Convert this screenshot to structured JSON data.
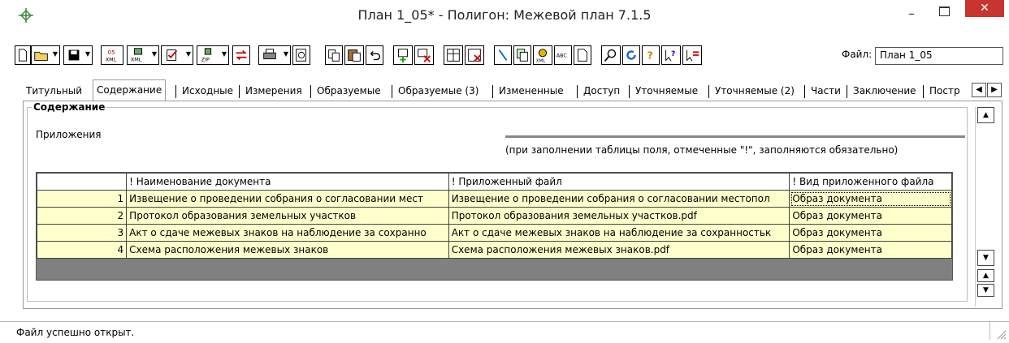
{
  "window": {
    "title": "План 1_05* - Полигон: Межевой план 7.1.5",
    "minimize": "–",
    "close": "✕"
  },
  "toolbar": {
    "file_label": "Файл:",
    "file_value": "План 1_05",
    "icons": [
      "new-document-icon",
      "open-folder-icon",
      "save-icon",
      "export-xml-05-icon",
      "import-xml-icon",
      "checklist-icon",
      "zip-icon",
      "sync-icon",
      "print-icon",
      "print-preview-icon",
      "copy-icon",
      "paste-icon",
      "undo-icon",
      "add-row-icon",
      "delete-row-icon",
      "insert-table-icon",
      "delete-table-icon",
      "pointer-icon",
      "copy-data-icon",
      "xml-cert-icon",
      "spellcheck-icon",
      "document-icon",
      "search-icon",
      "refresh-icon",
      "help-icon",
      "context-help-icon",
      "whats-this-icon"
    ]
  },
  "tabs": [
    {
      "label": "Титульный"
    },
    {
      "label": "Содержание",
      "active": true
    },
    {
      "label": "Исходные"
    },
    {
      "label": "Измерения"
    },
    {
      "label": "Образуемые"
    },
    {
      "label": "Образуемые (3)"
    },
    {
      "label": "Измененные"
    },
    {
      "label": "Доступ"
    },
    {
      "label": "Уточняемые"
    },
    {
      "label": "Уточняемые (2)"
    },
    {
      "label": "Части"
    },
    {
      "label": "Заключение"
    },
    {
      "label": "Постр"
    }
  ],
  "content": {
    "group_title": "Содержание",
    "sub_label": "Приложения",
    "hint": "(при заполнении таблицы поля, отмеченные \"!\", заполняются обязательно)",
    "table": {
      "columns": [
        "! Наименование документа",
        "! Приложенный файл",
        "! Вид приложенного файла"
      ],
      "rows": [
        {
          "n": "1",
          "name": "Извещение о проведении собрания о согласовании мест",
          "file": "Извещение о проведении собрания о согласовании местопол",
          "kind": "Образ документа"
        },
        {
          "n": "2",
          "name": "Протокол образования земельных участков",
          "file": "Протокол образования земельных участков.pdf",
          "kind": "Образ документа"
        },
        {
          "n": "3",
          "name": "Акт о сдаче межевых знаков на наблюдение за сохранно",
          "file": "Акт о сдаче межевых знаков на наблюдение за сохранностьк",
          "kind": "Образ документа"
        },
        {
          "n": "4",
          "name": "Схема расположения межевых знаков",
          "file": "Схема расположения межевых знаков.pdf",
          "kind": "Образ документа"
        }
      ]
    }
  },
  "status": {
    "text": "Файл успешно открыт."
  },
  "colors": {
    "close_button": "#c7352e",
    "row_fill": "#ffffcc",
    "grid_background": "#808080"
  }
}
